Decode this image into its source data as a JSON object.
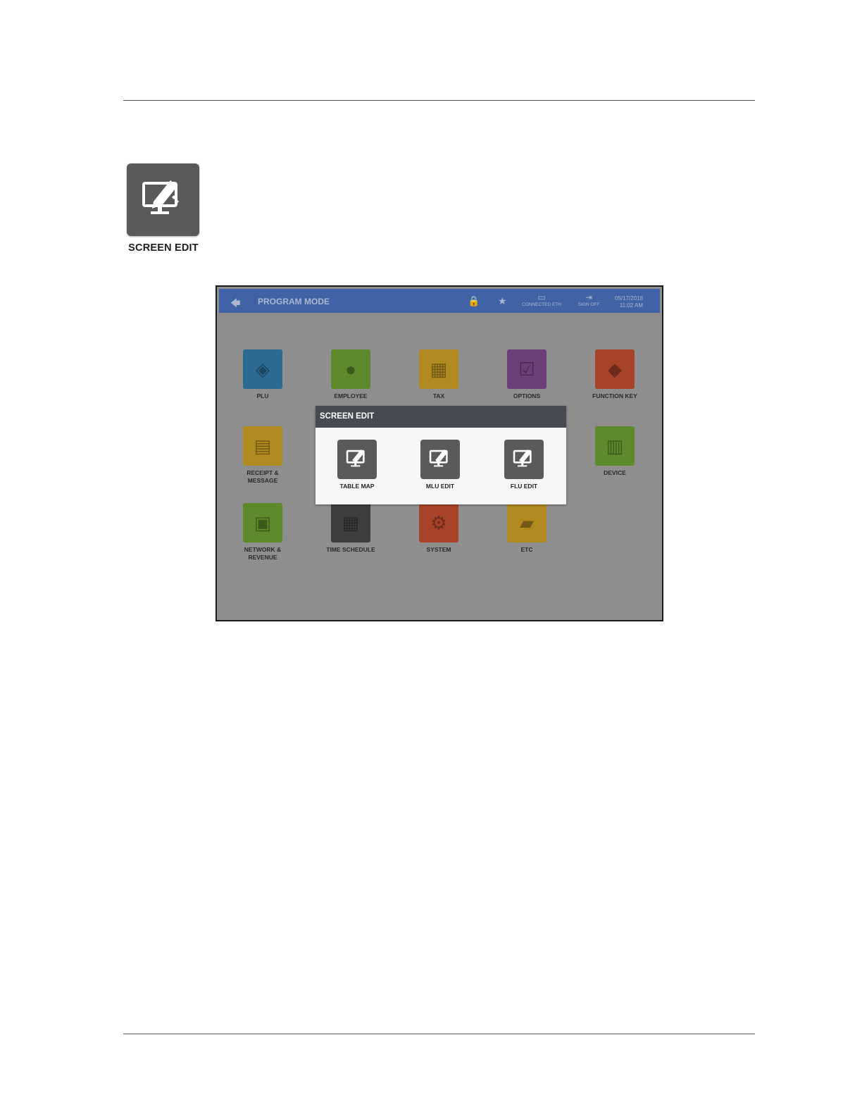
{
  "feature": {
    "label": "SCREEN EDIT",
    "icon": "screen-edit-icon"
  },
  "titlebar": {
    "back": "🡄",
    "title": "PROGRAM MODE",
    "lock_icon": "🔒",
    "star_icon": "★",
    "connected": "CONNECTED ETH",
    "signoff": "SIGN OFF",
    "date": "05/17/2018",
    "time": "11:02 AM"
  },
  "tiles": [
    {
      "label": "PLU",
      "color": "#2c6a92",
      "icon": "tag-icon"
    },
    {
      "label": "EMPLOYEE",
      "color": "#5e8a2c",
      "icon": "employee-icon"
    },
    {
      "label": "TAX",
      "color": "#b08a1e",
      "icon": "calculator-icon"
    },
    {
      "label": "OPTIONS",
      "color": "#6c3f79",
      "icon": "checklist-icon"
    },
    {
      "label": "FUNCTION KEY",
      "color": "#a8432a",
      "icon": "function-key-icon"
    },
    {
      "label": "RECEIPT & MESSAGE",
      "color": "#b08a1e",
      "icon": "receipt-icon"
    },
    {
      "label": "DEVICE",
      "color": "#5e8a2c",
      "icon": "device-icon"
    },
    {
      "label": "NETWORK & REVENUE",
      "color": "#5e8a2c",
      "icon": "network-icon"
    },
    {
      "label": "TIME SCHEDULE",
      "color": "#3e3e3e",
      "icon": "calendar-clock-icon"
    },
    {
      "label": "SYSTEM",
      "color": "#a8432a",
      "icon": "gear-wrench-icon"
    },
    {
      "label": "ETC",
      "color": "#b08a1e",
      "icon": "folder-icon"
    }
  ],
  "modal": {
    "title": "SCREEN EDIT",
    "buttons": [
      {
        "label": "TABLE MAP",
        "icon": "screen-edit-icon"
      },
      {
        "label": "MLU EDIT",
        "icon": "screen-edit-icon"
      },
      {
        "label": "FLU EDIT",
        "icon": "screen-edit-icon"
      }
    ]
  }
}
